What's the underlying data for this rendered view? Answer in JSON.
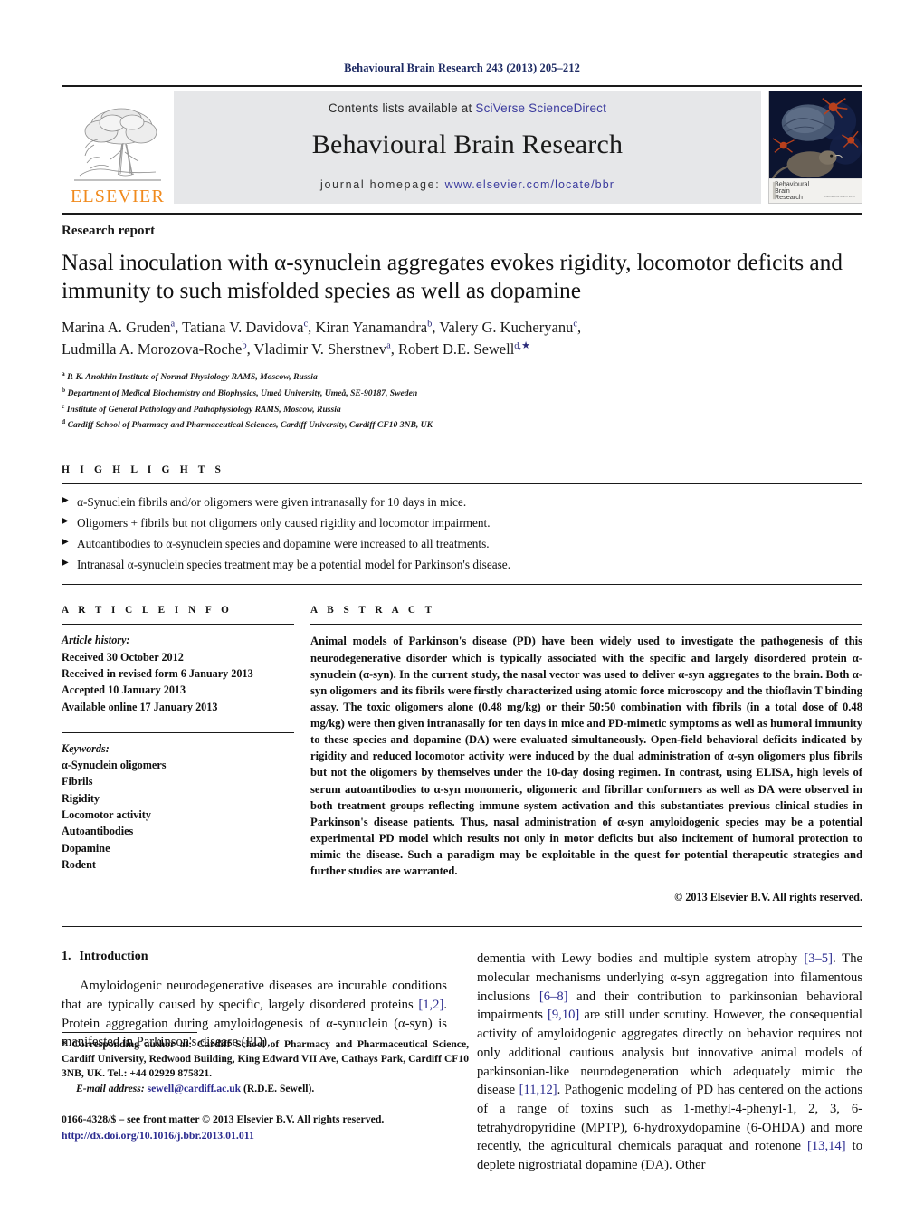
{
  "running_head": "Behavioural Brain Research 243 (2013) 205–212",
  "masthead": {
    "publisher_logo_label": "ELSEVIER",
    "contents_prefix": "Contents lists available at ",
    "contents_link": "SciVerse ScienceDirect",
    "journal_title": "Behavioural Brain Research",
    "homepage_prefix": "journal homepage: ",
    "homepage_link": "www.elsevier.com/locate/bbr",
    "cover_caption_line1": "Behavioural",
    "cover_caption_line2": "Brain",
    "cover_caption_line3": "Research"
  },
  "article": {
    "category": "Research report",
    "title": "Nasal inoculation with α-synuclein aggregates evokes rigidity, locomotor deficits and immunity to such misfolded species as well as dopamine",
    "authors_line1": "Marina A. Gruden a, Tatiana V. Davidova c, Kiran Yanamandra b, Valery G. Kucheryanu c,",
    "authors_line2": "Ludmilla A. Morozova-Roche b, Vladimir V. Sherstnev a, Robert D.E. Sewell d,*",
    "authors": [
      {
        "name": "Marina A. Gruden",
        "sup": "a",
        "sep": ", "
      },
      {
        "name": "Tatiana V. Davidova",
        "sup": "c",
        "sep": ", "
      },
      {
        "name": "Kiran Yanamandra",
        "sup": "b",
        "sep": ", "
      },
      {
        "name": "Valery G. Kucheryanu",
        "sup": "c",
        "sep": ","
      },
      {
        "name": "Ludmilla A. Morozova-Roche",
        "sup": "b",
        "sep": ", "
      },
      {
        "name": "Vladimir V. Sherstnev",
        "sup": "a",
        "sep": ", "
      },
      {
        "name": "Robert D.E. Sewell",
        "sup": "d,*",
        "sep": ""
      }
    ],
    "affiliations": [
      {
        "marker": "a",
        "text": "P. K. Anokhin Institute of Normal Physiology RAMS, Moscow, Russia"
      },
      {
        "marker": "b",
        "text": "Department of Medical Biochemistry and Biophysics, Umeå University, Umeå, SE-90187, Sweden"
      },
      {
        "marker": "c",
        "text": "Institute of General Pathology and Pathophysiology RAMS, Moscow, Russia"
      },
      {
        "marker": "d",
        "text": "Cardiff School of Pharmacy and Pharmaceutical Sciences, Cardiff University, Cardiff CF10 3NB, UK"
      }
    ]
  },
  "highlights": {
    "heading": "H I G H L I G H T S",
    "items": [
      "α-Synuclein fibrils and/or oligomers were given intranasally for 10 days in mice.",
      "Oligomers + fibrils but not oligomers only caused rigidity and locomotor impairment.",
      "Autoantibodies to α-synuclein species and dopamine were increased to all treatments.",
      "Intranasal α-synuclein species treatment may be a potential model for Parkinson's disease."
    ]
  },
  "article_info": {
    "heading": "A R T I C L E    I N F O",
    "history_label": "Article history:",
    "history": [
      "Received 30 October 2012",
      "Received in revised form 6 January 2013",
      "Accepted 10 January 2013",
      "Available online 17 January 2013"
    ],
    "keywords_label": "Keywords:",
    "keywords": [
      "α-Synuclein oligomers",
      "Fibrils",
      "Rigidity",
      "Locomotor activity",
      "Autoantibodies",
      "Dopamine",
      "Rodent"
    ]
  },
  "abstract": {
    "heading": "A B S T R A C T",
    "text": "Animal models of Parkinson's disease (PD) have been widely used to investigate the pathogenesis of this neurodegenerative disorder which is typically associated with the specific and largely disordered protein α-synuclein (α-syn). In the current study, the nasal vector was used to deliver α-syn aggregates to the brain. Both α-syn oligomers and its fibrils were firstly characterized using atomic force microscopy and the thioflavin T binding assay. The toxic oligomers alone (0.48 mg/kg) or their 50:50 combination with fibrils (in a total dose of 0.48 mg/kg) were then given intranasally for ten days in mice and PD-mimetic symptoms as well as humoral immunity to these species and dopamine (DA) were evaluated simultaneously. Open-field behavioral deficits indicated by rigidity and reduced locomotor activity were induced by the dual administration of α-syn oligomers plus fibrils but not the oligomers by themselves under the 10-day dosing regimen. In contrast, using ELISA, high levels of serum autoantibodies to α-syn monomeric, oligomeric and fibrillar conformers as well as DA were observed in both treatment groups reflecting immune system activation and this substantiates previous clinical studies in Parkinson's disease patients. Thus, nasal administration of α-syn amyloidogenic species may be a potential experimental PD model which results not only in motor deficits but also incitement of humoral protection to mimic the disease. Such a paradigm may be exploitable in the quest for potential therapeutic strategies and further studies are warranted.",
    "copyright": "© 2013 Elsevier B.V. All rights reserved."
  },
  "introduction": {
    "number": "1.",
    "heading": "Introduction",
    "left_paragraph_parts": [
      "Amyloidogenic neurodegenerative diseases are incurable conditions that are typically caused by specific, largely disordered proteins ",
      "[1,2]",
      ". Protein aggregation during amyloidogenesis of α-synuclein (α-syn) is manifested in Parkinson's disease (PD),"
    ],
    "right_paragraph_parts": [
      "dementia with Lewy bodies and multiple system atrophy ",
      "[3–5]",
      ". The molecular mechanisms underlying α-syn aggregation into filamentous inclusions ",
      "[6–8]",
      " and their contribution to parkinsonian behavioral impairments ",
      "[9,10]",
      " are still under scrutiny. However, the consequential activity of amyloidogenic aggregates directly on behavior requires not only additional cautious analysis but innovative animal models of parkinsonian-like neurodegeneration which adequately mimic the disease ",
      "[11,12]",
      ". Pathogenic modeling of PD has centered on the actions of a range of toxins such as 1-methyl-4-phenyl-1, 2, 3, 6-tetrahydropyridine (MPTP), 6-hydroxydopamine (6-OHDA) and more recently, the agricultural chemicals paraquat and rotenone ",
      "[13,14]",
      " to deplete nigrostriatal dopamine (DA). Other"
    ]
  },
  "footnote": {
    "corresponding": "* Corresponding author at: Cardiff School of Pharmacy and Pharmaceutical Science, Cardiff University, Redwood Building, King Edward VII Ave, Cathays Park, Cardiff CF10 3NB, UK. Tel.: +44 02929 875821.",
    "email_label": "E-mail address:",
    "email": "sewell@cardiff.ac.uk",
    "email_owner": "(R.D.E. Sewell).",
    "issn": "0166-4328/$ – see front matter © 2013 Elsevier B.V. All rights reserved.",
    "doi": "http://dx.doi.org/10.1016/j.bbr.2013.01.011"
  },
  "colors": {
    "link": "#3b3b9e",
    "reference": "#2b2b8f",
    "elsevier_orange": "#f08a1d",
    "band_grey": "#e6e7e9",
    "running_head": "#1d2a63"
  }
}
